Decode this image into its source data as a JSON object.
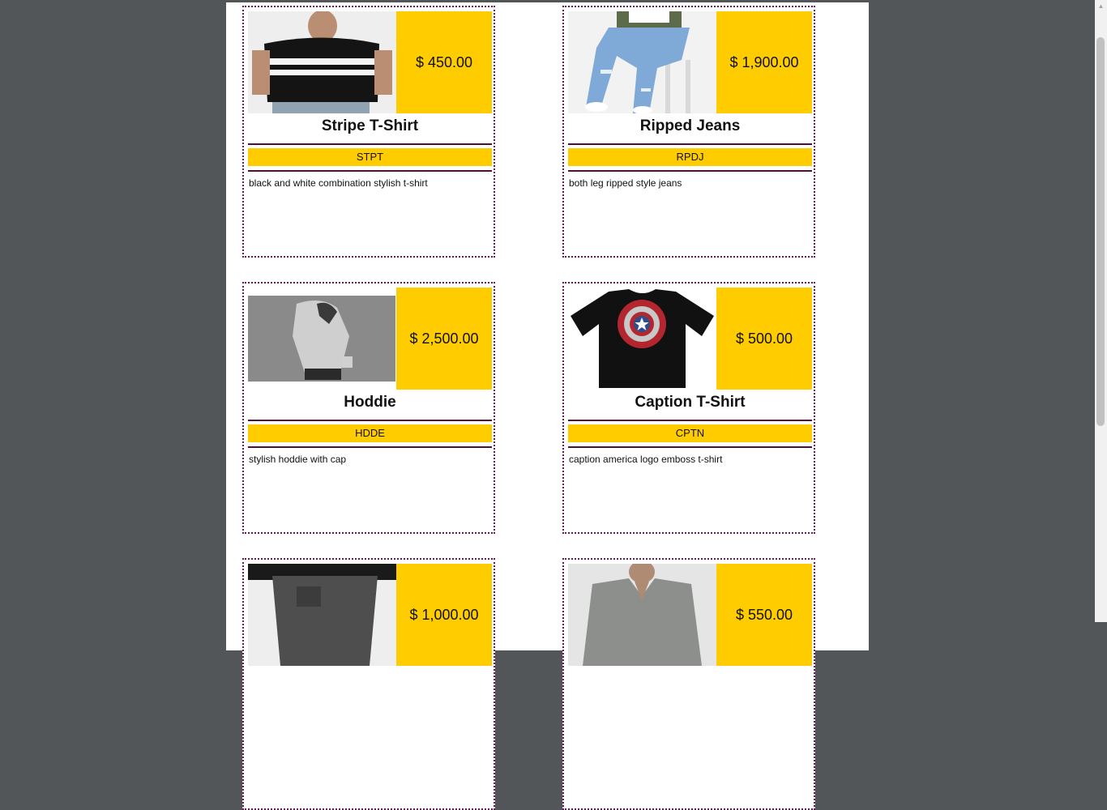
{
  "products": [
    {
      "name": "Stripe T-Shirt",
      "code": "STPT",
      "price": "$ 450.00",
      "description": "black and white combination stylish t-shirt"
    },
    {
      "name": "Ripped Jeans",
      "code": "RPDJ",
      "price": "$ 1,900.00",
      "description": "both leg ripped style jeans"
    },
    {
      "name": "Hoddie",
      "code": "HDDE",
      "price": "$ 2,500.00",
      "description": "stylish hoddie with cap"
    },
    {
      "name": "Caption T-Shirt",
      "code": "CPTN",
      "price": "$ 500.00",
      "description": "caption america logo emboss t-shirt"
    },
    {
      "price": "$ 1,000.00"
    },
    {
      "price": "$ 550.00"
    }
  ],
  "colors": {
    "price_bg": "#ffcc00",
    "border": "#6a1a55",
    "rule": "#4b0f3a",
    "viewer_bg": "#525659"
  },
  "icons": {
    "scroll_up": "chevron-up-icon"
  }
}
